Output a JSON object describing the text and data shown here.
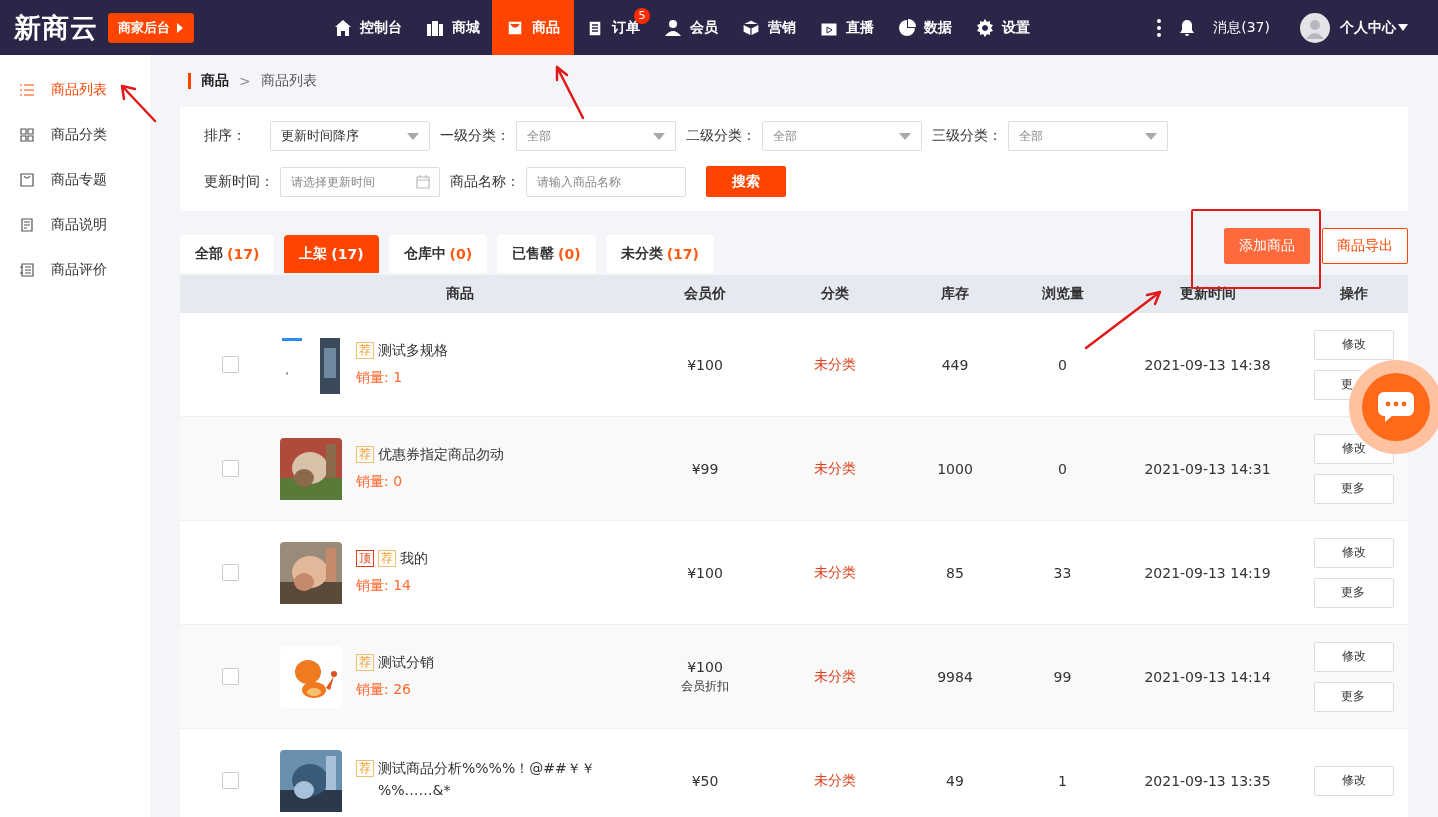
{
  "brand": {
    "logo": "新商云",
    "backend_button": "商家后台"
  },
  "nav": [
    {
      "label": "控制台",
      "selected": false
    },
    {
      "label": "商城",
      "selected": false
    },
    {
      "label": "商品",
      "selected": true
    },
    {
      "label": "订单",
      "selected": false,
      "badge": "5"
    },
    {
      "label": "会员",
      "selected": false
    },
    {
      "label": "营销",
      "selected": false
    },
    {
      "label": "直播",
      "selected": false
    },
    {
      "label": "数据",
      "selected": false
    },
    {
      "label": "设置",
      "selected": false
    }
  ],
  "top_right": {
    "messages": "消息(37)",
    "user": "个人中心"
  },
  "sidebar": [
    {
      "label": "商品列表",
      "selected": true
    },
    {
      "label": "商品分类",
      "selected": false
    },
    {
      "label": "商品专题",
      "selected": false
    },
    {
      "label": "商品说明",
      "selected": false
    },
    {
      "label": "商品评价",
      "selected": false
    }
  ],
  "breadcrumb": {
    "items": [
      "商品",
      "商品列表"
    ],
    "separator": ">"
  },
  "filters": [
    {
      "label": "排序：",
      "kind": "select",
      "value": "更新时间降序"
    },
    {
      "label": "一级分类：",
      "kind": "select",
      "placeholder": "全部"
    },
    {
      "label": "二级分类：",
      "kind": "select",
      "placeholder": "全部"
    },
    {
      "label": "三级分类：",
      "kind": "select",
      "placeholder": "全部"
    },
    {
      "label": "更新时间：",
      "kind": "date",
      "placeholder": "请选择更新时间"
    },
    {
      "label": "商品名称：",
      "kind": "text",
      "placeholder": "请输入商品名称"
    }
  ],
  "search_button": "搜索",
  "tabs": [
    {
      "label": "全部",
      "count": "(17)",
      "selected": false
    },
    {
      "label": "上架",
      "count": "(17)",
      "selected": true
    },
    {
      "label": "仓库中",
      "count": "(0)",
      "selected": false
    },
    {
      "label": "已售罄",
      "count": "(0)",
      "selected": false
    },
    {
      "label": "未分类",
      "count": "(17)",
      "selected": false
    }
  ],
  "actions": [
    {
      "label": "添加商品",
      "kind": "primary"
    },
    {
      "label": "商品导出",
      "kind": "outline"
    }
  ],
  "table": {
    "columns": [
      "商品",
      "会员价",
      "分类",
      "库存",
      "浏览量",
      "更新时间",
      "操作"
    ],
    "rows": [
      {
        "checked": false,
        "tags": [
          {
            "text": "荐",
            "kind": "recommend"
          }
        ],
        "name": "测试多规格",
        "sales": "销量: 1",
        "price": "¥100",
        "category": "未分类",
        "stock": "449",
        "views": "0",
        "updated": "2021-09-13 14:38",
        "actions": [
          "修改",
          "更"
        ]
      },
      {
        "checked": false,
        "tags": [
          {
            "text": "荐",
            "kind": "recommend"
          }
        ],
        "name": "优惠券指定商品勿动",
        "sales": "销量: 0",
        "price": "¥99",
        "category": "未分类",
        "stock": "1000",
        "views": "0",
        "updated": "2021-09-13 14:31",
        "actions": [
          "修改",
          "更多"
        ]
      },
      {
        "checked": false,
        "tags": [
          {
            "text": "顶",
            "kind": "top"
          },
          {
            "text": "荐",
            "kind": "recommend"
          }
        ],
        "name": "我的",
        "sales": "销量: 14",
        "price": "¥100",
        "category": "未分类",
        "stock": "85",
        "views": "33",
        "updated": "2021-09-13 14:19",
        "actions": [
          "修改",
          "更多"
        ]
      },
      {
        "checked": false,
        "tags": [
          {
            "text": "荐",
            "kind": "recommend"
          }
        ],
        "name": "测试分销",
        "sales": "销量: 26",
        "price": "¥100",
        "price_note": "会员折扣",
        "category": "未分类",
        "stock": "9984",
        "views": "99",
        "updated": "2021-09-13 14:14",
        "actions": [
          "修改",
          "更多"
        ]
      },
      {
        "checked": false,
        "tags": [
          {
            "text": "荐",
            "kind": "recommend"
          }
        ],
        "name": "测试商品分析%%%%！@##￥￥%%……&*",
        "price": "¥50",
        "category": "未分类",
        "stock": "49",
        "views": "1",
        "updated": "2021-09-13 13:35",
        "actions": [
          "修改"
        ]
      }
    ]
  }
}
